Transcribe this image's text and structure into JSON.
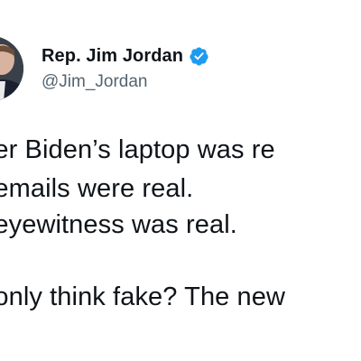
{
  "tweet": {
    "author": {
      "display_name": "Rep. Jim Jordan",
      "handle": "@Jim_Jordan",
      "verified_icon": "verified-badge-icon",
      "avatar": "profile-photo"
    },
    "body_lines": [
      "nter Biden’s laptop was re",
      "e emails were real.",
      "e eyewitness was real.",
      "e only think fake? The new"
    ]
  },
  "colors": {
    "text": "#0f1419",
    "handle": "#536471",
    "verified": "#1d9bf0",
    "background": "#ffffff"
  }
}
